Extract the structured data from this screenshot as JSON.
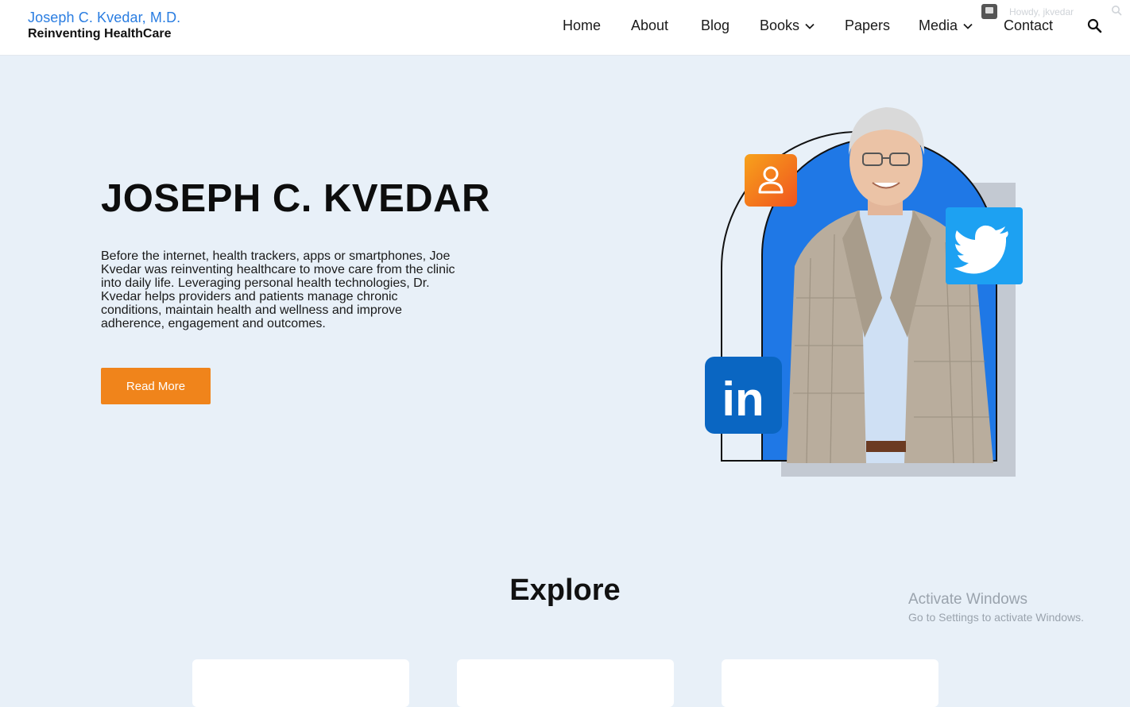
{
  "brand": {
    "name": "Joseph C. Kvedar, M.D.",
    "tagline": "Reinventing HealthCare"
  },
  "nav": {
    "items": [
      {
        "label": "Home",
        "has_dropdown": false
      },
      {
        "label": "About",
        "has_dropdown": false
      },
      {
        "label": "Blog",
        "has_dropdown": false
      },
      {
        "label": "Books",
        "has_dropdown": true
      },
      {
        "label": "Papers",
        "has_dropdown": false
      },
      {
        "label": "Media",
        "has_dropdown": true
      },
      {
        "label": "Contact",
        "has_dropdown": false
      }
    ],
    "search_icon": "search-icon"
  },
  "admin_bar": {
    "greeting": "Howdy, jkvedar",
    "comment_icon": "comment-icon",
    "search_icon": "search-icon"
  },
  "hero": {
    "title": "JOSEPH C. KVEDAR",
    "body": "Before the internet, health trackers, apps or smartphones, Joe Kvedar was reinventing healthcare to move care from the clinic into daily life. Leveraging personal health technologies, Dr. Kvedar helps providers and patients manage chronic conditions, maintain health and wellness and improve adherence, engagement and outcomes.",
    "button_label": "Read More"
  },
  "portrait": {
    "social_icons": [
      "profile-icon",
      "twitter-icon",
      "linkedin-icon"
    ],
    "linkedin_text": "in"
  },
  "explore": {
    "title": "Explore"
  },
  "watermark": {
    "title": "Activate Windows",
    "subtitle": "Go to Settings to activate Windows."
  },
  "colors": {
    "brand_blue": "#2a7de1",
    "accent_orange": "#f0841b",
    "hero_bg": "#e8f0f8",
    "arch_blue": "#1f78e6",
    "twitter": "#1da1f2",
    "linkedin": "#0a66c2"
  }
}
